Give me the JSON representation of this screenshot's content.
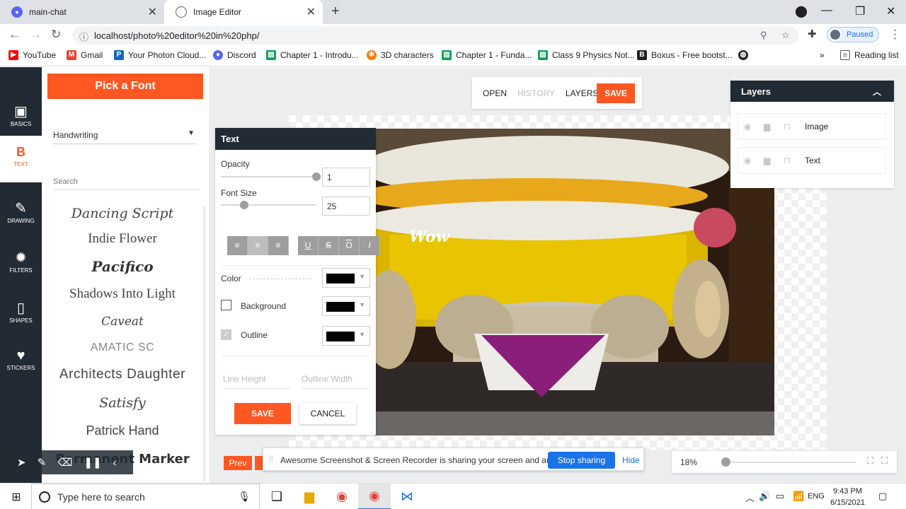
{
  "browser": {
    "tabs": [
      {
        "title": "main-chat"
      },
      {
        "title": "Image Editor"
      }
    ],
    "url": "localhost/photo%20editor%20in%20php/",
    "profile_status": "Paused",
    "bookmarks": [
      {
        "label": "YouTube",
        "color": "#ff0000"
      },
      {
        "label": "Gmail",
        "color": "#ea4335"
      },
      {
        "label": "Your Photon Cloud...",
        "color": "#1565c0"
      },
      {
        "label": "Discord",
        "color": "#5865f2"
      },
      {
        "label": "Chapter 1 - Introdu...",
        "color": "#0f9d58"
      },
      {
        "label": "3D characters",
        "color": "#ff7a00"
      },
      {
        "label": "Chapter 1 - Funda...",
        "color": "#0f9d58"
      },
      {
        "label": "Class 9 Physics Not...",
        "color": "#0f9d58"
      },
      {
        "label": "Boxus - Free bootst...",
        "color": "#222222"
      }
    ],
    "reading_list": "Reading list"
  },
  "sidenav": {
    "items": [
      {
        "label": "BASICS",
        "icon": "image-icon"
      },
      {
        "label": "TEXT",
        "icon": "bold-b-icon"
      },
      {
        "label": "DRAWING",
        "icon": "brush-icon"
      },
      {
        "label": "FILTERS",
        "icon": "filter-icon"
      },
      {
        "label": "SHAPES",
        "icon": "shape-icon"
      },
      {
        "label": "STICKERS",
        "icon": "heart-icon"
      }
    ]
  },
  "fontpanel": {
    "title": "Pick a Font",
    "category": "Handwriting",
    "search_placeholder": "Search",
    "fonts": [
      "Dancing Script",
      "Indie Flower",
      "Pacifico",
      "Shadows Into Light",
      "Caveat",
      "AMATIC SC",
      "Architects Daughter",
      "Satisfy",
      "Patrick Hand",
      "Permanent Marker"
    ]
  },
  "topbar": {
    "open": "OPEN",
    "history": "HISTORY",
    "layers": "LAYERS",
    "save": "SAVE"
  },
  "layers_panel": {
    "title": "Layers",
    "items": [
      {
        "name": "Image"
      },
      {
        "name": "Text"
      }
    ]
  },
  "text_panel": {
    "title": "Text",
    "opacity_label": "Opacity",
    "opacity_value": "1",
    "opacity_fraction": 1.0,
    "font_size_label": "Font Size",
    "font_size_value": "25",
    "color_label": "Color",
    "background_label": "Background",
    "outline_label": "Outline",
    "line_height_placeholder": "Line Height",
    "outline_width_placeholder": "Outline Width",
    "save": "SAVE",
    "cancel": "CANCEL",
    "swatch_color": "#000000"
  },
  "canvas": {
    "overlay_text": "Wow"
  },
  "bottom": {
    "prev": "Prev",
    "zoom": "18%",
    "share_message": "Awesome Screenshot & Screen Recorder is sharing your screen and audio.",
    "stop_sharing": "Stop sharing",
    "hide": "Hide"
  },
  "taskbar": {
    "search_placeholder": "Type here to search",
    "language": "ENG",
    "time": "9:43 PM",
    "date": "6/15/2021"
  },
  "colors": {
    "accent": "#fe5722",
    "dark": "#222a33",
    "link": "#1a73e8"
  }
}
